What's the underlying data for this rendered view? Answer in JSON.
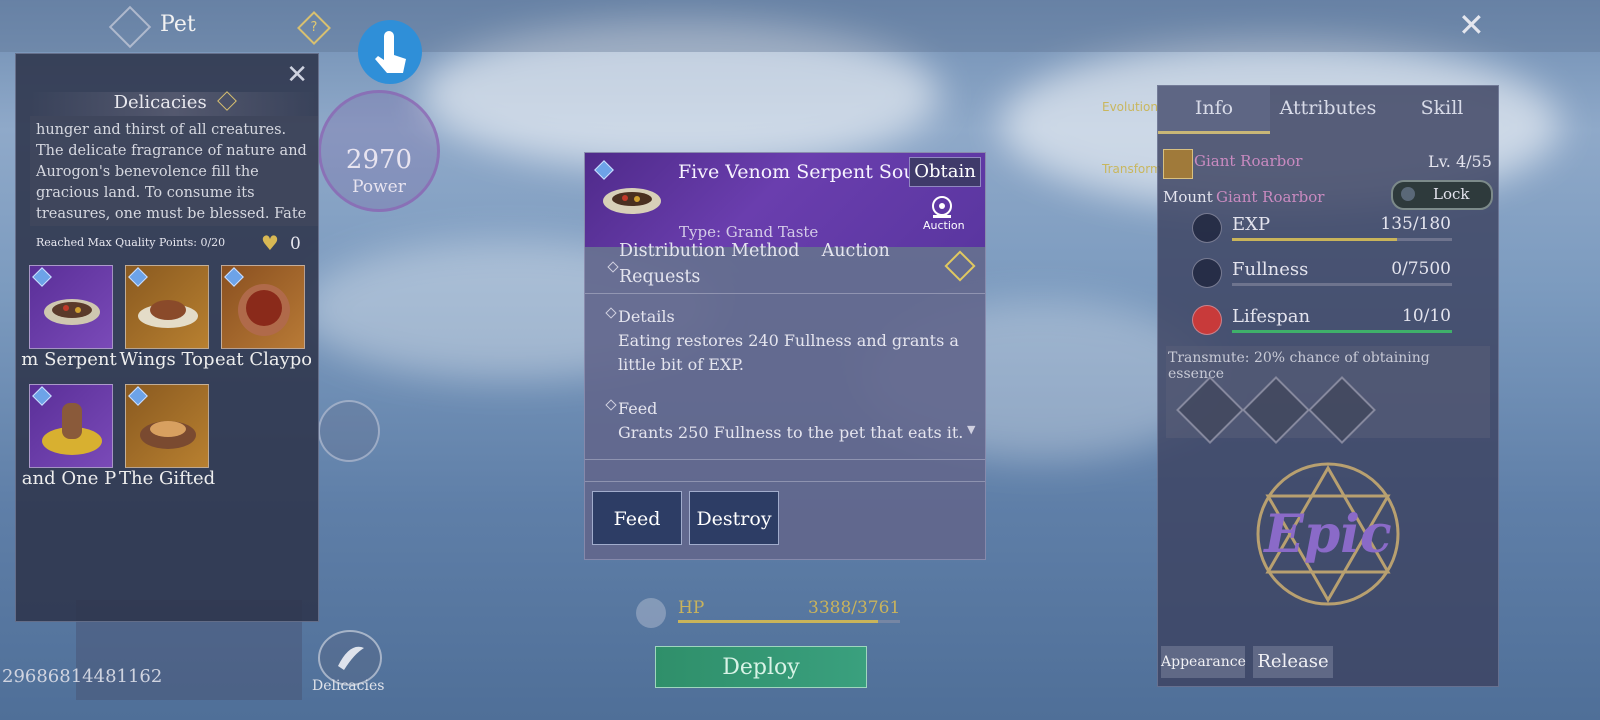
{
  "top": {
    "title": "Pet"
  },
  "power": {
    "value": "2970",
    "label": "Power"
  },
  "bottom_id": "29686814481162",
  "delicacies_nav": {
    "label": "Delicacies"
  },
  "left_panel": {
    "title": "Delicacies",
    "description": "hunger and thirst of all creatures. The delicate fragrance of nature and Aurogon's benevolence fill the gracious land. To consume its treasures, one must be blessed. Fate",
    "reached_max": "Reached Max Quality Points: 0/20",
    "points": "0",
    "items": [
      {
        "label": "m Serpent",
        "color": "#6c3aa8"
      },
      {
        "label": "Wings Top",
        "color": "#a07028"
      },
      {
        "label": "eat Claypo",
        "color": "#a86a2c"
      },
      {
        "label": "and One P",
        "color": "#6c3aa8"
      },
      {
        "label": "The Gifted",
        "color": "#a87030"
      }
    ]
  },
  "popup": {
    "name": "Five Venom Serpent Soup",
    "obtain": "Obtain",
    "auction_label": "Auction",
    "type": "Type: Grand Taste",
    "distribution_line1": "Distribution Method    Auction",
    "distribution_line2": "Requests",
    "details_heading": "Details",
    "details_line1": "Eating restores 240 Fullness and grants a",
    "details_line2": "little bit of EXP.",
    "feed_heading": "Feed",
    "feed_line1": "Grants 250 Fullness to the pet that eats it.",
    "feed_button": "Feed",
    "destroy_button": "Destroy"
  },
  "hp": {
    "label": "HP",
    "value": "3388/3761",
    "fraction": 0.9
  },
  "deploy": "Deploy",
  "side_links": {
    "evolution": "Evolution",
    "transform": "Transform"
  },
  "right_panel": {
    "tabs": [
      "Info",
      "Attributes",
      "Skill"
    ],
    "pet_name": "Giant Roarbor",
    "level": "Lv. 4/55",
    "mount_label": "Mount",
    "mount_name": "Giant Roarbor",
    "lock_label": "Lock",
    "stats": [
      {
        "label": "EXP",
        "value": "135/180",
        "fraction": 0.75,
        "color": "#c9b45a"
      },
      {
        "label": "Fullness",
        "value": "0/7500",
        "fraction": 0.0,
        "color": "#c9b45a"
      },
      {
        "label": "Lifespan",
        "value": "10/10",
        "fraction": 1.0,
        "color": "#3fb06a"
      }
    ],
    "transmute": "Transmute: 20% chance of obtaining essence",
    "rarity": "Epic",
    "appearance_button": "Appearance",
    "release_button": "Release"
  }
}
